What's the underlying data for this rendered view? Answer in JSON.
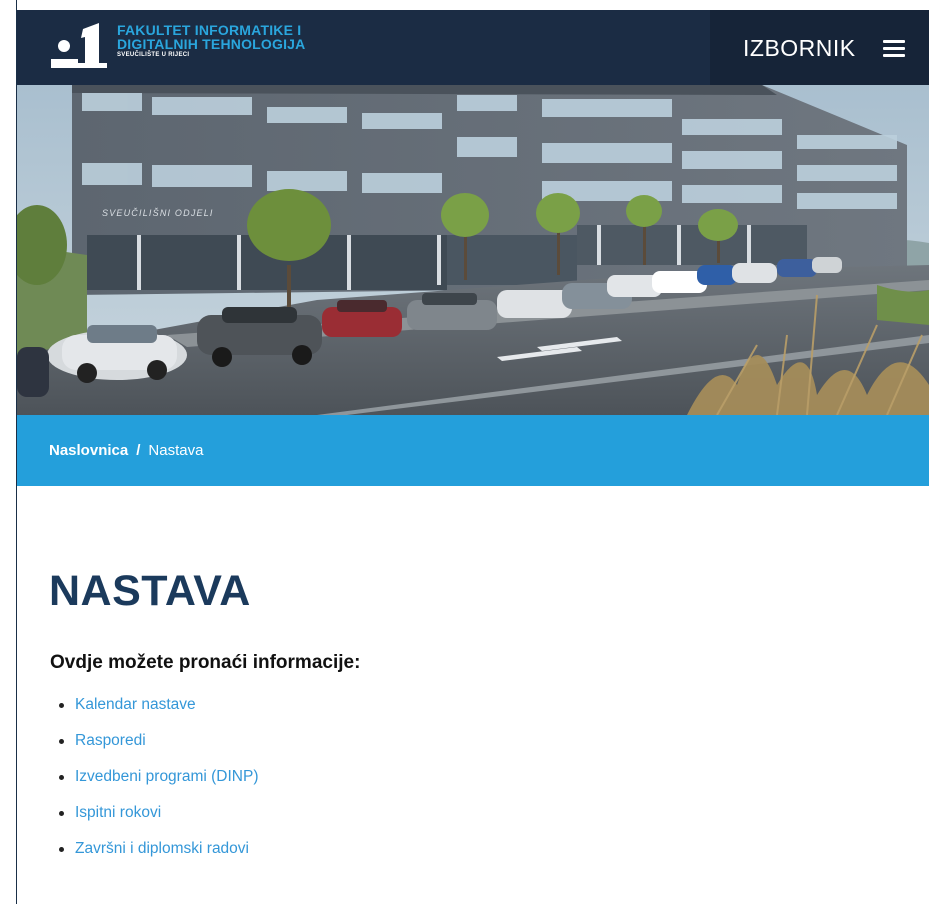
{
  "header": {
    "logo_line1": "FAKULTET INFORMATIKE I",
    "logo_line2": "DIGITALNIH TEHNOLOGIJA",
    "logo_sub": "SVEUČILIŠTE U RIJECI",
    "menu_label": "IZBORNIK",
    "menu_icon": "hamburger-icon",
    "colors": {
      "bar": "#1b2c44",
      "menu_block": "#162438",
      "logo_accent": "#2aa6dd"
    }
  },
  "hero": {
    "building_sign": "SVEUČILIŠNI ODJELI"
  },
  "breadcrumb": {
    "home": "Naslovnica",
    "separator": "/",
    "current": "Nastava",
    "color": "#249fdb"
  },
  "content": {
    "title": "NASTAVA",
    "lead": "Ovdje možete pronaći informacije:",
    "links": [
      "Kalendar nastave",
      "Rasporedi",
      "Izvedbeni programi (DINP)",
      "Ispitni rokovi",
      "Završni i diplomski radovi"
    ],
    "link_color": "#3497d8",
    "title_color": "#1b3a5c"
  }
}
